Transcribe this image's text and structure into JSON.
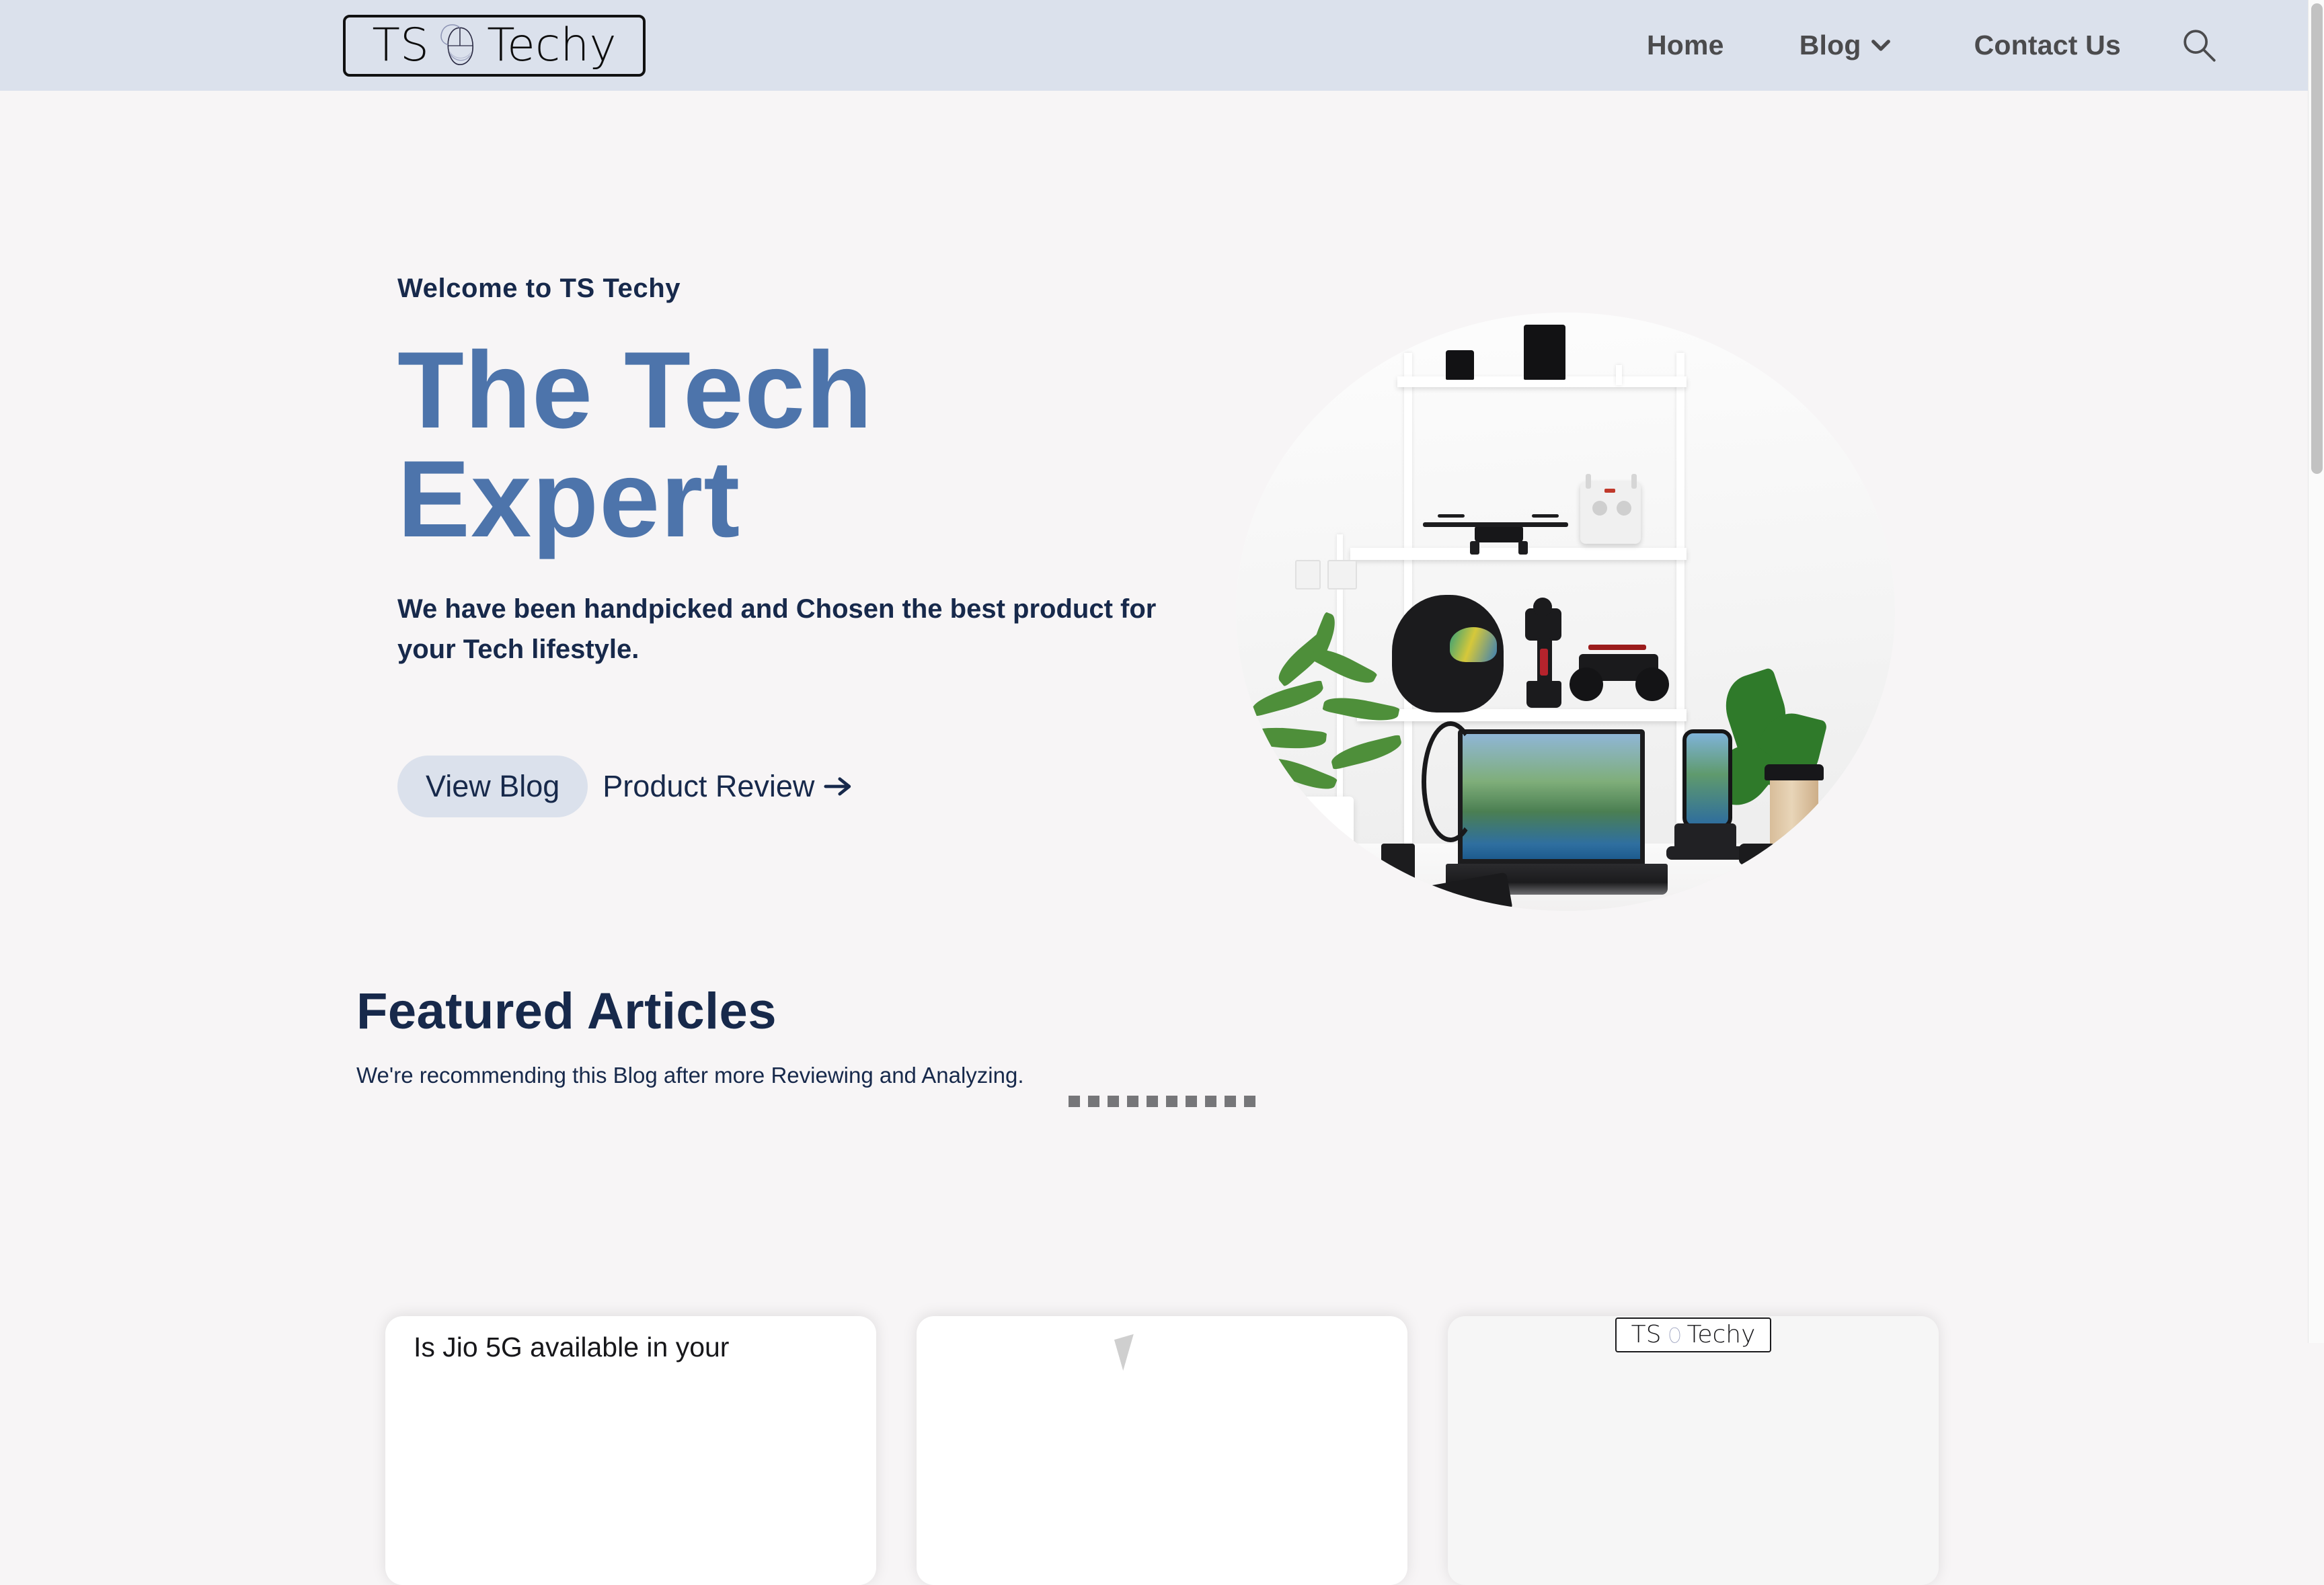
{
  "header": {
    "logo": {
      "left_text": "TS",
      "right_text": "Techy",
      "icon": "computer-mouse-icon"
    },
    "nav": [
      {
        "label": "Home",
        "has_dropdown": false
      },
      {
        "label": "Blog",
        "has_dropdown": true,
        "icon": "chevron-down-icon"
      },
      {
        "label": "Contact Us",
        "has_dropdown": false
      }
    ],
    "search_icon": "search-icon",
    "background_color": "#dbe1ec",
    "nav_text_color": "#4b4b4d"
  },
  "hero": {
    "eyebrow": "Welcome to TS Techy",
    "title": "The Tech Expert",
    "title_color": "#4d74ab",
    "subtitle": "We have been handpicked and Chosen the best product for your Tech lifestyle.",
    "primary_button": "View Blog",
    "secondary_link": "Product Review",
    "secondary_link_icon": "arrow-right-icon",
    "image_alt": "tech-desk-setup-photo",
    "carousel_dot_count": 10,
    "carousel_dot_color": "#767679"
  },
  "featured": {
    "title": "Featured Articles",
    "subtitle": "We're recommending this Blog after more Reviewing and Analyzing.",
    "title_color": "#17294b",
    "cards": [
      {
        "title": "Is Jio 5G available in your",
        "type": "text-card"
      },
      {
        "title": "",
        "type": "image-card"
      },
      {
        "title": "",
        "type": "logo-card",
        "logo_left": "TS",
        "logo_right": "Techy"
      }
    ]
  },
  "page": {
    "background_color": "#f7f5f6",
    "accent_color": "#17294b"
  },
  "scrollbar": {
    "thumb_color": "#c2c2c2",
    "track_color": "#fafafa"
  }
}
